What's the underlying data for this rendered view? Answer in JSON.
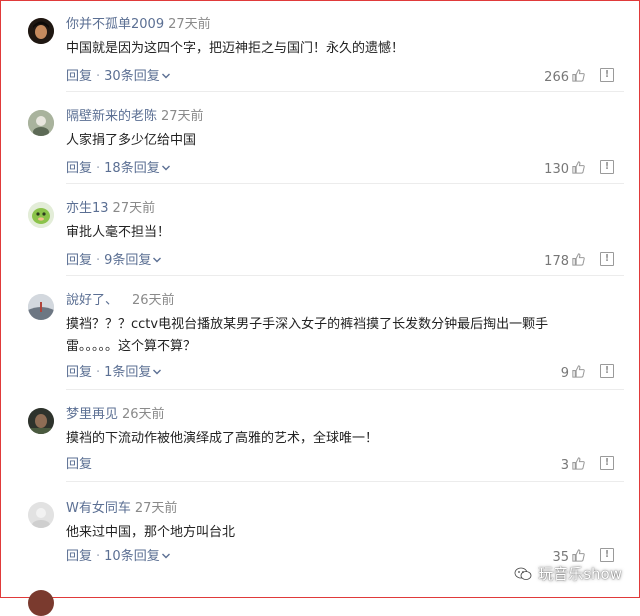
{
  "comments": [
    {
      "username": "你并不孤单2009",
      "time": "27天前",
      "text": "中国就是因为这四个字，把迈神拒之与国门！永久的遗憾！",
      "reply_label": "回复",
      "replies_label": "30条回复",
      "likes": "266"
    },
    {
      "username": "隔壁新来的老陈",
      "time": "27天前",
      "text": "人家捐了多少亿给中国",
      "reply_label": "回复",
      "replies_label": "18条回复",
      "likes": "130"
    },
    {
      "username": "亦生13",
      "time": "27天前",
      "text": "审批人毫不担当！",
      "reply_label": "回复",
      "replies_label": "9条回复",
      "likes": "178"
    },
    {
      "username": "說好了、",
      "time": "26天前",
      "text": "摸裆？？？cctv电视台播放某男子手深入女子的裤裆摸了长发数分钟最后掏出一颗手雷。。。。。这个算不算？",
      "reply_label": "回复",
      "replies_label": "1条回复",
      "likes": "9"
    },
    {
      "username": "梦里再见",
      "time": "26天前",
      "text": "摸裆的下流动作被他演绎成了高雅的艺术，全球唯一！",
      "reply_label": "回复",
      "replies_label": "",
      "likes": "3"
    },
    {
      "username": "W有女同车",
      "time": "27天前",
      "text": "他来过中国，那个地方叫台北",
      "reply_label": "回复",
      "replies_label": "10条回复",
      "likes": "35"
    }
  ],
  "watermark": "玩音乐show",
  "colors": {
    "username": "#5b6f93",
    "border": "#e03a3a",
    "muted": "#8a8a8a"
  },
  "icons": {
    "like": "thumbs-up-icon",
    "report": "report-icon",
    "expand": "chevron-down-icon",
    "watermark": "wechat-icon"
  }
}
